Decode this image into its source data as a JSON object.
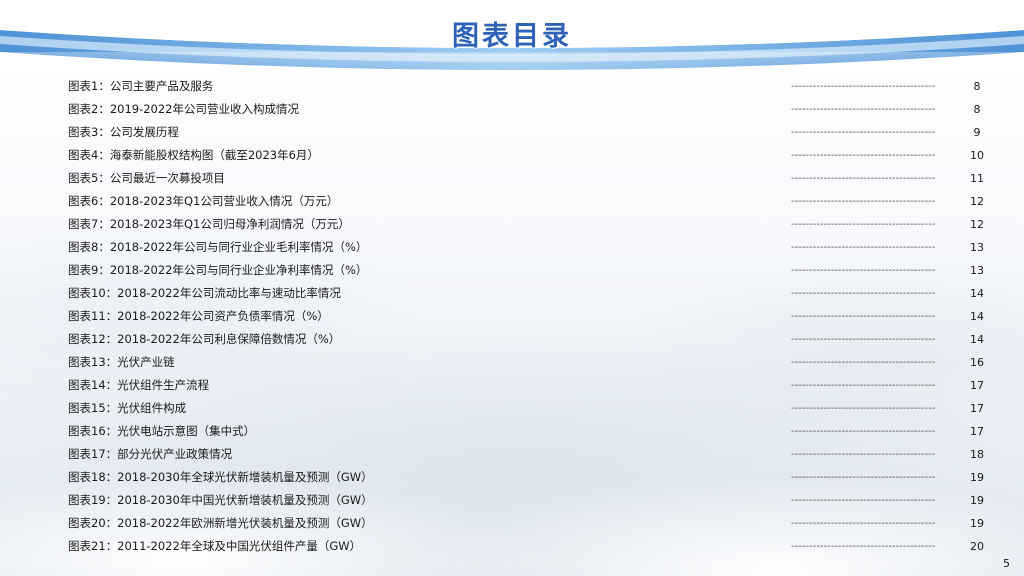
{
  "title": "图表目录",
  "slide_number": "5",
  "leader": "----------------------------------------",
  "entries": [
    {
      "label": "图表1：公司主要产品及服务",
      "page": "8"
    },
    {
      "label": "图表2：2019-2022年公司营业收入构成情况",
      "page": "8"
    },
    {
      "label": "图表3：公司发展历程",
      "page": "9"
    },
    {
      "label": "图表4：海泰新能股权结构图（截至2023年6月）",
      "page": "10"
    },
    {
      "label": "图表5：公司最近一次募投项目",
      "page": "11"
    },
    {
      "label": "图表6：2018-2023年Q1公司营业收入情况（万元）",
      "page": "12"
    },
    {
      "label": "图表7：2018-2023年Q1公司归母净利润情况（万元）",
      "page": "12"
    },
    {
      "label": "图表8：2018-2022年公司与同行业企业毛利率情况（%）",
      "page": "13"
    },
    {
      "label": "图表9：2018-2022年公司与同行业企业净利率情况（%）",
      "page": "13"
    },
    {
      "label": "图表10：2018-2022年公司流动比率与速动比率情况",
      "page": "14"
    },
    {
      "label": "图表11：2018-2022年公司资产负债率情况（%）",
      "page": "14"
    },
    {
      "label": "图表12：2018-2022年公司利息保障倍数情况（%）",
      "page": "14"
    },
    {
      "label": "图表13：光伏产业链",
      "page": "16"
    },
    {
      "label": "图表14：光伏组件生产流程",
      "page": "17"
    },
    {
      "label": "图表15：光伏组件构成",
      "page": "17"
    },
    {
      "label": "图表16：光伏电站示意图（集中式）",
      "page": "17"
    },
    {
      "label": "图表17：部分光伏产业政策情况",
      "page": "18"
    },
    {
      "label": "图表18：2018-2030年全球光伏新增装机量及预测（GW）",
      "page": "19"
    },
    {
      "label": "图表19：2018-2030年中国光伏新增装机量及预测（GW）",
      "page": "19"
    },
    {
      "label": "图表20：2018-2022年欧洲新增光伏装机量及预测（GW）",
      "page": "19"
    },
    {
      "label": "图表21：2011-2022年全球及中国光伏组件产量（GW）",
      "page": "20"
    }
  ]
}
